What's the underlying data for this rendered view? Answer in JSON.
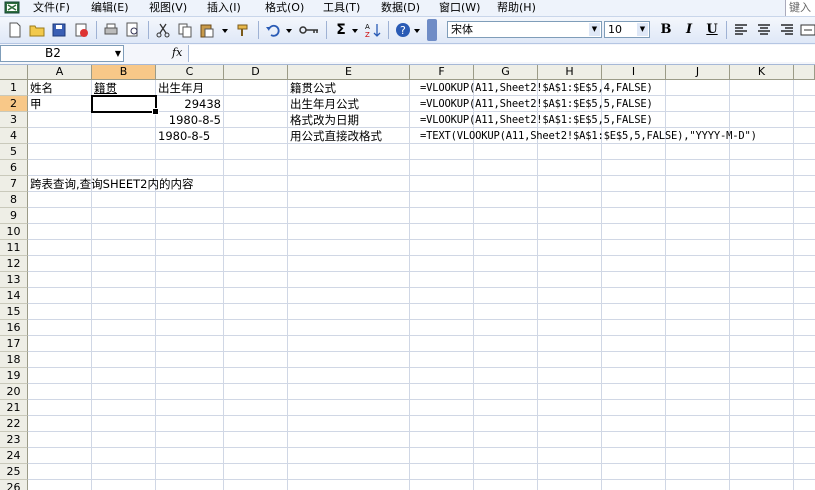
{
  "menu": {
    "items": [
      "文件(F)",
      "编辑(E)",
      "视图(V)",
      "插入(I)",
      "格式(O)",
      "工具(T)",
      "数据(D)",
      "窗口(W)",
      "帮助(H)"
    ],
    "help_placeholder": "键入"
  },
  "toolbar": {
    "font_name": "宋体",
    "font_size": "10",
    "bold_label": "B",
    "italic_label": "I",
    "underline_label": "U",
    "sum_label": "Σ"
  },
  "formula_bar": {
    "name_box": "B2",
    "fx_label": "fx",
    "formula": ""
  },
  "grid": {
    "columns": [
      "A",
      "B",
      "C",
      "D",
      "E",
      "F",
      "G",
      "H",
      "I",
      "J",
      "K"
    ],
    "rows": [
      "1",
      "2",
      "3",
      "4",
      "5",
      "6",
      "7",
      "8",
      "9",
      "10",
      "11",
      "12",
      "13",
      "14",
      "15",
      "16",
      "17",
      "18",
      "19",
      "20",
      "21",
      "22",
      "23",
      "24",
      "25",
      "26"
    ],
    "active_cell": "B2",
    "cells": {
      "A1": "姓名",
      "B1": "籍贯",
      "C1": "出生年月",
      "E1": "籍贯公式",
      "F1": "=VLOOKUP(A11,Sheet2!$A$1:$E$5,4,FALSE)",
      "A2": "甲",
      "C2": "29438",
      "E2": "出生年月公式",
      "F2": "=VLOOKUP(A11,Sheet2!$A$1:$E$5,5,FALSE)",
      "C3": "1980-8-5",
      "E3": "格式改为日期",
      "F3": "=VLOOKUP(A11,Sheet2!$A$1:$E$5,5,FALSE)",
      "C4": "1980-8-5",
      "E4": "用公式直接改格式",
      "F4": "=TEXT(VLOOKUP(A11,Sheet2!$A$1:$E$5,5,FALSE),\"YYYY-M-D\")",
      "A7": "跨表查询,查询SHEET2内的内容"
    }
  }
}
